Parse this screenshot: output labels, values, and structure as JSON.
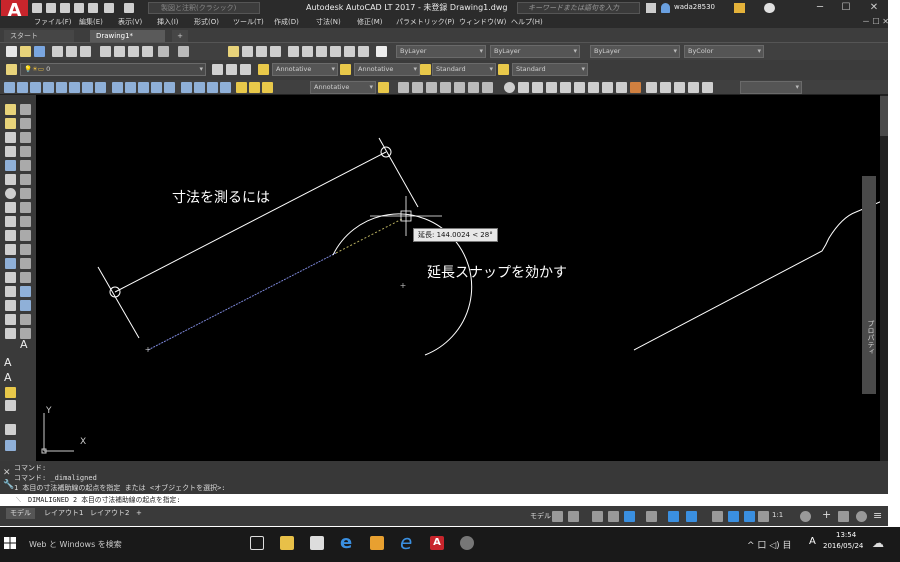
{
  "app": {
    "logo_letter": "A",
    "logo_sub": "LT",
    "title": "Autodesk AutoCAD LT 2017 - 未登録    Drawing1.dwg",
    "workspace": "製図と注釈(クラシック)",
    "search_placeholder": "キーワードまたは語句を入力",
    "user": "wada28530",
    "win_minimize": "─",
    "win_maximize": "☐",
    "win_close": "✕"
  },
  "menu": {
    "items": [
      "ファイル(F)",
      "編集(E)",
      "表示(V)",
      "挿入(I)",
      "形式(O)",
      "ツール(T)",
      "作成(D)",
      "寸法(N)",
      "修正(M)",
      "パラメトリック(P)",
      "ウィンドウ(W)",
      "ヘルプ(H)"
    ]
  },
  "tabs": {
    "start": "スタート",
    "drawing": "Drawing1*",
    "new": "+"
  },
  "toolbar": {
    "layer_color": "ByLayer",
    "linetype": "ByLayer",
    "lineweight": "ByLayer",
    "plot_color": "ByColor",
    "layer": "0",
    "text_style": "Annotative",
    "dim_style": "Annotative",
    "table_style": "Standard",
    "mleader_style": "Standard",
    "dim_style_2": "Annotative"
  },
  "canvas": {
    "annotation_1": "寸法を測るには",
    "annotation_2": "延長スナップを効かす",
    "tooltip": "延長: 144.0024 < 28°",
    "ucs_y": "Y",
    "ucs_x": "X"
  },
  "right_panel": {
    "label": "プロパティ"
  },
  "command": {
    "history": [
      "コマンド:",
      "コマンド: _dimaligned",
      "1 本目の寸法補助線の起点を指定 または <オブジェクトを選択>:"
    ],
    "prompt": "DIMALIGNED 2 本目の寸法補助線の起点を指定:"
  },
  "layout_tabs": [
    "モデル",
    "レイアウト1",
    "レイアウト2",
    "+"
  ],
  "statusbar": {
    "model": "モデル",
    "scale": "1:1"
  },
  "taskbar": {
    "search": "Web と Windows を検索",
    "ime": "A",
    "time": "13:54",
    "date": "2016/05/24"
  },
  "colors": {
    "autocad_red": "#c8252c",
    "canvas_bg": "#000000",
    "dark_ui": "#3a3a3a"
  }
}
